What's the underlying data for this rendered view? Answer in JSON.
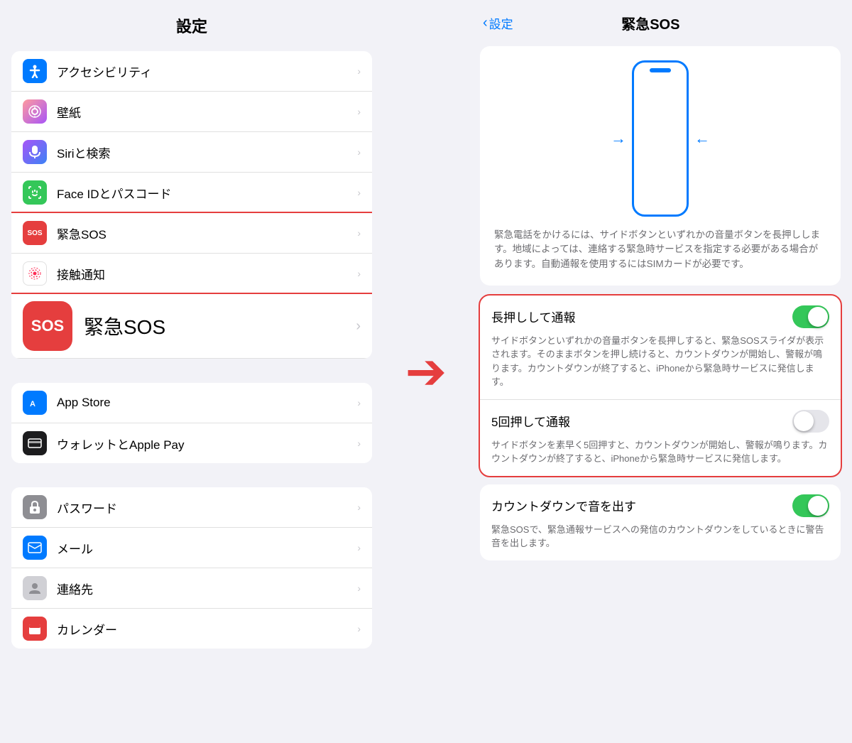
{
  "left": {
    "header": "設定",
    "items_group1": [
      {
        "id": "accessibility",
        "label": "アクセシビリティ",
        "icon_type": "blue",
        "icon": "♿"
      },
      {
        "id": "wallpaper",
        "label": "壁紙",
        "icon_type": "gradient_pink",
        "icon": "✿"
      },
      {
        "id": "siri",
        "label": "Siriと検索",
        "icon_type": "dark",
        "icon": "🎤"
      },
      {
        "id": "faceid",
        "label": "Face IDとパスコード",
        "icon_type": "green",
        "icon": "😃"
      },
      {
        "id": "sos",
        "label": "緊急SOS",
        "icon_type": "red",
        "icon": "SOS",
        "highlighted": true
      },
      {
        "id": "exposure",
        "label": "接触通知",
        "icon_type": "pink_dots",
        "icon": "⊙"
      }
    ],
    "sos_promo": {
      "icon_text": "SOS",
      "label": "緊急SOS"
    },
    "items_group2": [
      {
        "id": "appstore",
        "label": "App Store",
        "icon_type": "blue",
        "icon": "A"
      },
      {
        "id": "wallet",
        "label": "ウォレットとApple Pay",
        "icon_type": "dark",
        "icon": "💳"
      }
    ],
    "items_group3": [
      {
        "id": "password",
        "label": "パスワード",
        "icon_type": "gray",
        "icon": "🔑"
      },
      {
        "id": "mail",
        "label": "メール",
        "icon_type": "blue",
        "icon": "✉"
      },
      {
        "id": "contacts",
        "label": "連絡先",
        "icon_type": "light_gray",
        "icon": "👤"
      },
      {
        "id": "calendar",
        "label": "カレンダー",
        "icon_type": "red_cal",
        "icon": "📅"
      }
    ]
  },
  "arrow": "→",
  "right": {
    "back_label": "設定",
    "title": "緊急SOS",
    "phone_desc": "緊急電話をかけるには、サイドボタンといずれかの音量ボタンを長押しします。地域によっては、連絡する緊急時サービスを指定する必要がある場合があります。自動通報を使用するにはSIMカードが必要です。",
    "toggle1_label": "長押しして通報",
    "toggle1_on": true,
    "toggle1_desc": "サイドボタンといずれかの音量ボタンを長押しすると、緊急SOSスライダが表示されます。そのままボタンを押し続けると、カウントダウンが開始し、警報が鳴ります。カウントダウンが終了すると、iPhoneから緊急時サービスに発信します。",
    "toggle2_label": "5回押して通報",
    "toggle2_on": false,
    "toggle2_desc": "サイドボタンを素早く5回押すと、カウントダウンが開始し、警報が鳴ります。カウントダウンが終了すると、iPhoneから緊急時サービスに発信します。",
    "toggle3_label": "カウントダウンで音を出す",
    "toggle3_on": true,
    "toggle3_desc": "緊急SOSで、緊急通報サービスへの発信のカウントダウンをしているときに警告音を出します。"
  }
}
